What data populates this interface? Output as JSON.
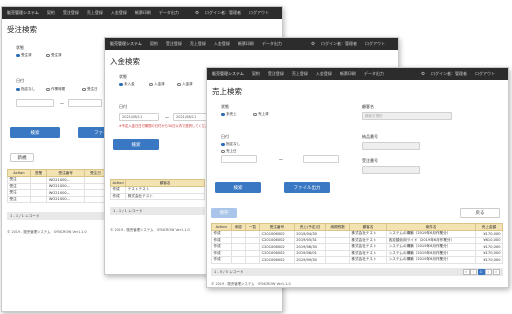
{
  "app": {
    "brand": "販売管理システム",
    "menu": [
      "契約",
      "受注登録",
      "売上登録",
      "入金登録",
      "帳票印刷",
      "データ出力"
    ],
    "login_label": "ログイン者：管理者",
    "logout_label": "ログアウト",
    "settings_icon": "gear-icon"
  },
  "win1": {
    "title": "受注検索",
    "status_label": "状態",
    "status_options": [
      "受注済",
      "受注済"
    ],
    "date_label": "日付",
    "date_options": [
      "指定なし",
      "作業時間",
      "受注日"
    ],
    "tilde": "〜",
    "search_btn": "検索",
    "file_btn": "ファイル",
    "new_btn": "新規",
    "table_headers": [
      "Action",
      "営業",
      "受注番号",
      "受注日"
    ],
    "rows": [
      [
        "受注",
        "",
        "WO21000...",
        ""
      ],
      [
        "受注",
        "",
        "WO21000...",
        ""
      ],
      [
        "受注",
        "",
        "WO21000...",
        ""
      ],
      [
        "受注",
        "",
        "WO21000...",
        ""
      ]
    ],
    "footer": "1 - 1 / 1 レコード",
    "copyright": "© 2019 - 販売管理システム　SYNCROW Ver1.1.0"
  },
  "win2": {
    "title": "入金検索",
    "status_label": "状態",
    "status_options": [
      "未入金",
      "入金済",
      "入金済"
    ],
    "date_label": "日付",
    "date_from": "2021/08/11",
    "date_to": "2021/08/11",
    "tilde": "〜",
    "error_text": "※予定入金日日付期間の日付から30日以内で選択してください",
    "search_btn": "検索",
    "table_headers": [
      "Action",
      "顧客名"
    ],
    "rows": [
      [
        "作成",
        "テストテスト"
      ],
      [
        "作成",
        "株式会社テスト"
      ]
    ],
    "footer": "1 - 1 / 1 レコード",
    "copyright": "© 2019 - 販売管理システム　SYNCROW Ver1.1.0"
  },
  "win3": {
    "title": "売上検索",
    "status_label": "状態",
    "status_options": [
      "未売上",
      "売上済"
    ],
    "date_label": "日付",
    "date_options": [
      "指定なし",
      "売上日"
    ],
    "tilde": "〜",
    "customer_label": "顧客名",
    "customer_placeholder": "顧客を選択",
    "payment_no_label": "納品番号",
    "order_no_label": "受注番号",
    "search_btn": "検索",
    "file_btn": "ファイル出力",
    "save_btn": "保存",
    "back_btn": "戻る",
    "table_headers": [
      "Action",
      "承認",
      "一覧",
      "受注番号",
      "売上(予定)日",
      "納期残数",
      "顧客名",
      "案件名",
      "売上金額"
    ],
    "rows": [
      [
        "作成",
        "",
        "",
        "C201006002",
        "2019/04/30",
        "",
        "株式会社テスト",
        "システムの構築（2019年6月作業分）",
        "¥170,000"
      ],
      [
        "作成",
        "",
        "",
        "C201006002",
        "2019/05/31",
        "",
        "株式会社テスト",
        "各定額化用ライド（2019年6月作業分）",
        "¥610,000"
      ],
      [
        "作成",
        "",
        "",
        "C201006002",
        "2019/06/30",
        "",
        "株式会社テスト",
        "システムの構築（2019年6月作業分）",
        "¥170,000"
      ],
      [
        "作成",
        "",
        "",
        "C201006002",
        "2019/08/01",
        "",
        "株式会社テスト",
        "システムの構築（2019年6月作業分）",
        "¥170,000"
      ],
      [
        "作成",
        "",
        "",
        "C201006002",
        "2019/09/30",
        "",
        "株式会社テスト",
        "システムの構築（2019年6月作業分）",
        "¥170,000"
      ]
    ],
    "footer": "1 - 5 / 5 レコード",
    "pager": [
      "«",
      "‹",
      "1",
      "›",
      "»"
    ],
    "copyright": "© 2019 - 販売管理システム　SYNCROW Ver1.1.0"
  }
}
